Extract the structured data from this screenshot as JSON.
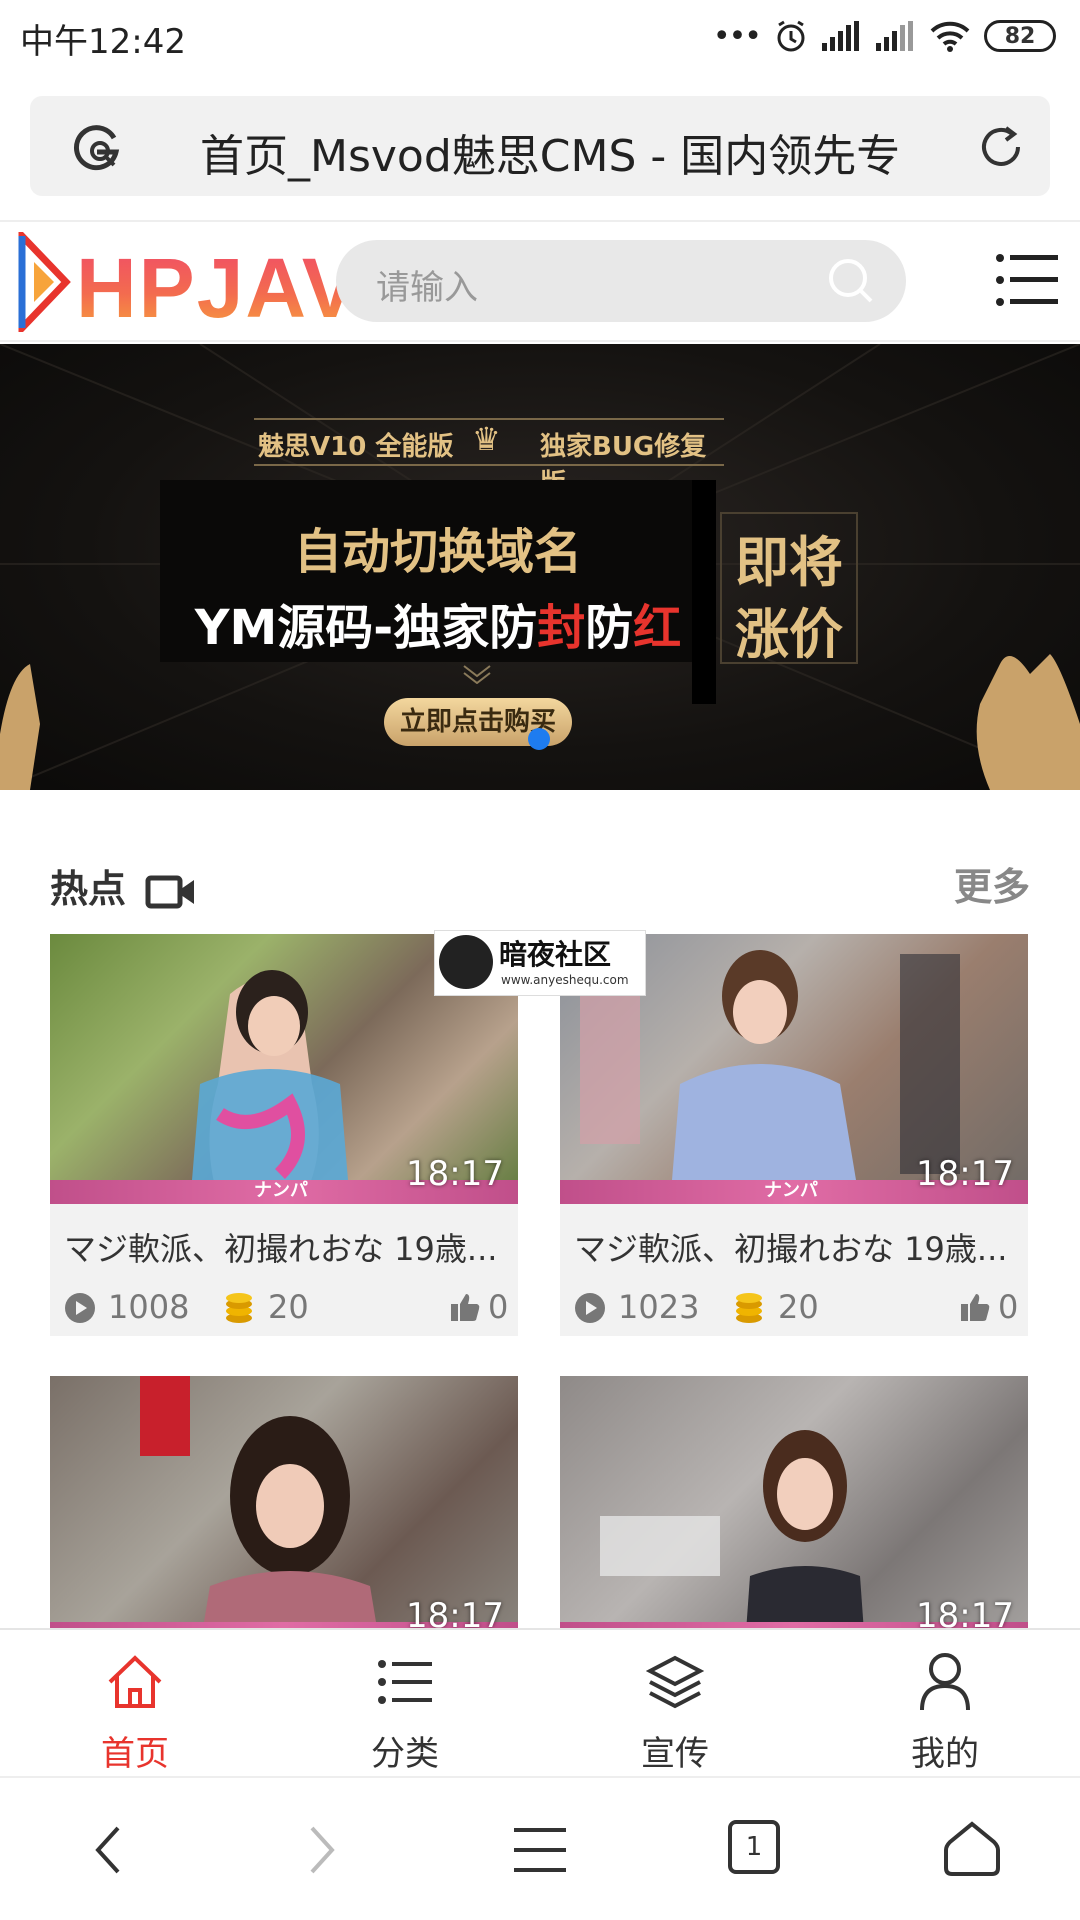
{
  "status_bar": {
    "time": "中午12:42",
    "battery": "82"
  },
  "browser": {
    "address_text": "首页_Msvod魅思CMS - 国内领先专"
  },
  "site": {
    "logo": "HPJAV",
    "search_placeholder": "请输入"
  },
  "banner": {
    "top_left": "魅思V10 全能版",
    "top_right": "独家BUG修复版",
    "line1": "自动切换域名",
    "line2_prefix": "YM源码-独家防",
    "line2_red1": "封",
    "line2_mid": "防",
    "line2_red2": "红",
    "side1": "即将",
    "side2": "涨价",
    "cta": "立即点击购买"
  },
  "watermark": {
    "title": "暗夜社区",
    "url": "www.anyeshequ.com"
  },
  "section": {
    "title": "热点",
    "more": "更多"
  },
  "cards": [
    {
      "title": "マジ軟派、初撮れおな 19歳...",
      "duration": "18:17",
      "views": "1008",
      "coins": "20",
      "likes": "0",
      "channel": "ナンパ"
    },
    {
      "title": "マジ軟派、初撮れおな 19歳...",
      "duration": "18:17",
      "views": "1023",
      "coins": "20",
      "likes": "0",
      "channel": "ナンパ"
    },
    {
      "duration": "18:17"
    },
    {
      "duration": "18:17"
    }
  ],
  "tabs": [
    {
      "label": "首页",
      "active": true
    },
    {
      "label": "分类"
    },
    {
      "label": "宣传"
    },
    {
      "label": "我的"
    }
  ],
  "nav": {
    "tab_count": "1"
  },
  "colors": {
    "accent": "#e8342d",
    "coin": "#f0b400",
    "banner_gold": "#e2c184"
  }
}
